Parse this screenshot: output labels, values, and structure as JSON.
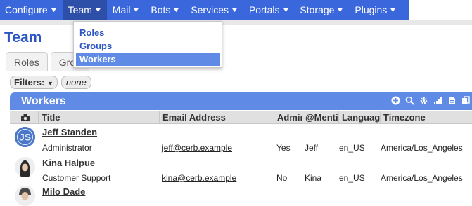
{
  "nav": {
    "items": [
      {
        "label": "Configure"
      },
      {
        "label": "Team"
      },
      {
        "label": "Mail"
      },
      {
        "label": "Bots"
      },
      {
        "label": "Services"
      },
      {
        "label": "Portals"
      },
      {
        "label": "Storage"
      },
      {
        "label": "Plugins"
      }
    ],
    "active": "Team",
    "accent_color": "#3b67dd"
  },
  "dropdown": {
    "items": [
      {
        "label": "Roles"
      },
      {
        "label": "Groups"
      },
      {
        "label": "Workers",
        "selected": true
      }
    ]
  },
  "page": {
    "title": "Team"
  },
  "tabs": [
    {
      "label": "Roles"
    },
    {
      "label": "Grou"
    }
  ],
  "filters": {
    "label": "Filters:",
    "value": "none"
  },
  "worklist": {
    "title": "Workers",
    "header_color": "#5f8ae5",
    "toolbar_icons": [
      "add-icon",
      "search-icon",
      "gear-icon",
      "chart-icon",
      "export-icon",
      "copy-icon"
    ],
    "columns": [
      "Title",
      "Email Address",
      "Admin",
      "@Menti",
      "Language",
      "Timezone"
    ],
    "rows": [
      {
        "name": "Jeff Standen",
        "title": "Administrator",
        "email": "jeff@cerb.example",
        "admin": "Yes",
        "mention": "Jeff",
        "language": "en_US",
        "timezone": "America/Los_Angeles",
        "avatar": "initials-avatar",
        "avatar_text": "JS"
      },
      {
        "name": "Kina Halpue",
        "title": "Customer Support",
        "email": "kina@cerb.example",
        "admin": "No",
        "mention": "Kina",
        "language": "en_US",
        "timezone": "America/Los_Angeles",
        "avatar": "photo-avatar"
      },
      {
        "name": "Milo Dade",
        "avatar": "photo-avatar"
      }
    ]
  }
}
